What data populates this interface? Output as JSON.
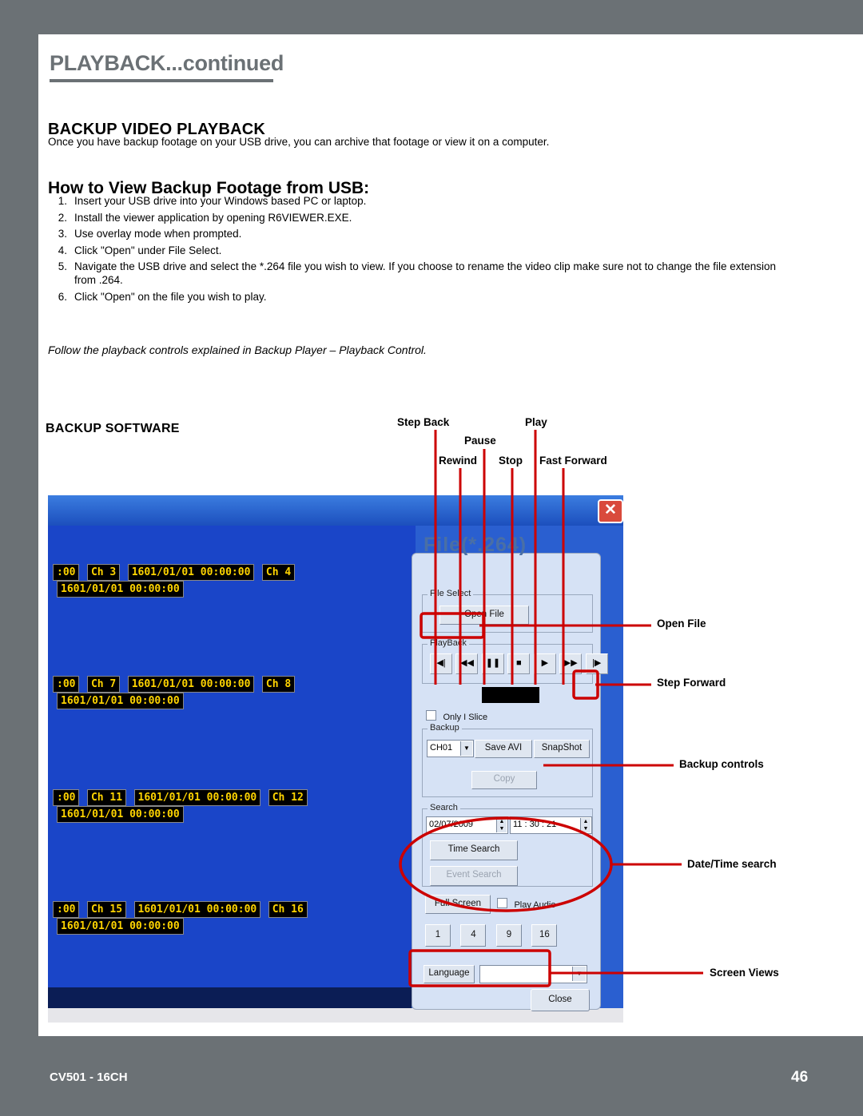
{
  "header": {
    "chapter_title": "PLAYBACK...continued"
  },
  "section": {
    "title": "BACKUP VIDEO PLAYBACK",
    "description": "Once you have backup footage on your USB drive, you can archive that footage or view it on a computer.",
    "subtitle": "How to View Backup Footage from USB:",
    "steps": [
      {
        "num": "1.",
        "text": "Insert your USB drive into your Windows based PC or laptop."
      },
      {
        "num": "2.",
        "text": "Install the viewer application by opening R6VIEWER.EXE."
      },
      {
        "num": "3.",
        "text": "Use overlay mode when prompted."
      },
      {
        "num": "4.",
        "text": "Click \"Open\" under File Select."
      },
      {
        "num": "5.",
        "text": "Navigate  the USB drive and select the *.264 file you wish to view. If you choose to rename the video clip make sure not to change the file extension from .264."
      },
      {
        "num": "6.",
        "text": "Click \"Open\" on the file you wish to play."
      }
    ],
    "note": "Follow the playback controls explained in Backup Player – Playback Control.",
    "software_label": "BACKUP SOFTWARE"
  },
  "top_callouts": [
    {
      "label": "Step Back"
    },
    {
      "label": "Play"
    },
    {
      "label": "Pause"
    },
    {
      "label": "Rewind"
    },
    {
      "label": "Stop"
    },
    {
      "label": "Fast Forward"
    }
  ],
  "right_callouts": [
    {
      "label": "Open File"
    },
    {
      "label": "Step Forward"
    },
    {
      "label": "Backup controls"
    },
    {
      "label": "Date/Time search"
    },
    {
      "label": "Screen Views"
    }
  ],
  "app": {
    "window_title": "File(*.264)",
    "close_icon": "close-icon",
    "groups": {
      "file_select": "File Select",
      "playback": "PlayBack",
      "backup": "Backup",
      "search": "Search"
    },
    "open_file_button": "Open File",
    "transport_icons": [
      "step-back-icon",
      "rewind-icon",
      "pause-icon",
      "stop-icon",
      "play-icon",
      "fast-forward-icon",
      "step-forward-icon"
    ],
    "only_i_slice": "Only I Slice",
    "channel_select": "CH01",
    "save_avi_button": "Save AVI",
    "snapshot_button": "SnapShot",
    "copy_button": "Copy",
    "search_date": "02/07/2009",
    "search_time": "11 : 30 : 21",
    "time_search_button": "Time Search",
    "event_search_button": "Event Search",
    "full_screen_button": "Full Screen",
    "play_audio": "Play Audio",
    "screen_views": [
      "1",
      "4",
      "9",
      "16"
    ],
    "language_label": "Language",
    "language_value": "",
    "close_button": "Close"
  },
  "video_grid": {
    "rows": [
      {
        "time_left": ":00",
        "ch_a": "Ch 3",
        "time_a": "1601/01/01 00:00:00",
        "ch_b": "Ch 4",
        "time_b": "1601/01/01 00:00:00"
      },
      {
        "time_left": ":00",
        "ch_a": "Ch 7",
        "time_a": "1601/01/01 00:00:00",
        "ch_b": "Ch 8",
        "time_b": "1601/01/01 00:00:00"
      },
      {
        "time_left": ":00",
        "ch_a": "Ch 11",
        "time_a": "1601/01/01 00:00:00",
        "ch_b": "Ch 12",
        "time_b": "1601/01/01 00:00:00"
      },
      {
        "time_left": ":00",
        "ch_a": "Ch 15",
        "time_a": "1601/01/01 00:00:00",
        "ch_b": "Ch 16",
        "time_b": "1601/01/01 00:00:00"
      }
    ]
  },
  "footer": {
    "model": "CV501 - 16CH",
    "page": "46"
  },
  "colors": {
    "gray": "#6b7175",
    "callout_red": "#cc0000",
    "panel": "#d6e2f5",
    "video_blue": "#1a45c8",
    "osd_yellow": "#ffd400"
  }
}
